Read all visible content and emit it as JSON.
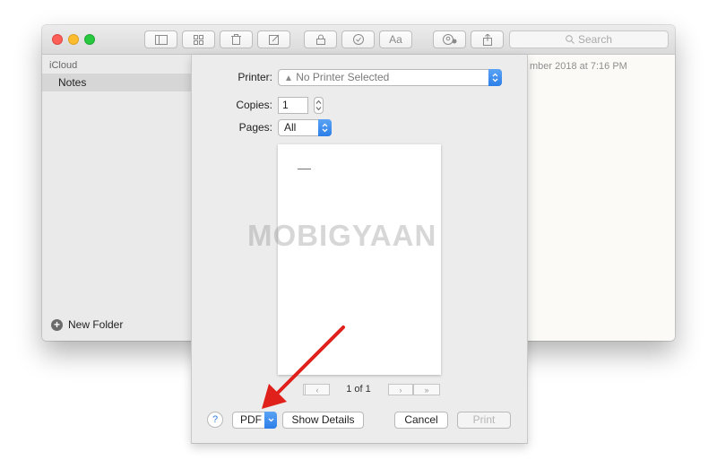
{
  "sidebar": {
    "header": "iCloud",
    "selected_folder": "Notes",
    "new_folder_label": "New Folder"
  },
  "note": {
    "date_fragment": "mber 2018 at 7:16 PM"
  },
  "toolbar": {
    "search_placeholder": "Search",
    "format_label": "Aa"
  },
  "print_dialog": {
    "printer_label": "Printer:",
    "printer_value": "No Printer Selected",
    "copies_label": "Copies:",
    "copies_value": "1",
    "pages_label": "Pages:",
    "pages_value": "All",
    "page_indicator": "1 of 1",
    "help_label": "?",
    "pdf_label": "PDF",
    "show_details_label": "Show Details",
    "cancel_label": "Cancel",
    "print_label": "Print"
  },
  "watermark": "MOBIGYAAN",
  "colors": {
    "accent": "#2c7ee8",
    "arrow": "#e0201a"
  }
}
